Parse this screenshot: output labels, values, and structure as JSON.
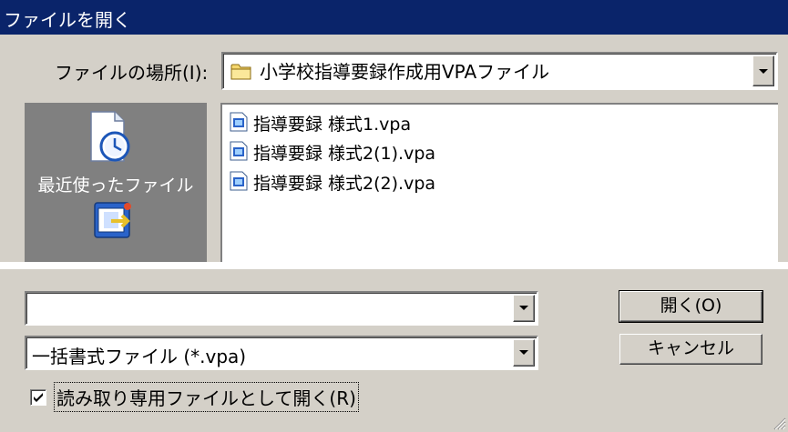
{
  "window": {
    "title": "ファイルを開く"
  },
  "look_in": {
    "label": "ファイルの場所(I):",
    "value": "小学校指導要録作成用VPAファイル",
    "icon": "folder-icon"
  },
  "places_bar": {
    "items": [
      {
        "label": "最近使ったファイル",
        "icon": "recent-files-icon"
      },
      {
        "label": "",
        "icon": "desktop-icon"
      }
    ]
  },
  "file_list": {
    "items": [
      {
        "name": "指導要録 様式1.vpa",
        "icon": "vpa-file-icon"
      },
      {
        "name": "指導要録 様式2(1).vpa",
        "icon": "vpa-file-icon"
      },
      {
        "name": "指導要録 様式2(2).vpa",
        "icon": "vpa-file-icon"
      }
    ]
  },
  "file_name": {
    "value": ""
  },
  "file_type": {
    "value": "一括書式ファイル (*.vpa)"
  },
  "buttons": {
    "open": "開く(O)",
    "cancel": "キャンセル"
  },
  "read_only": {
    "label": "読み取り専用ファイルとして開く(R)",
    "checked": true
  },
  "colors": {
    "title_bar": "#0a246a",
    "dialog_bg": "#d4d0c8",
    "places_bg": "#808080"
  }
}
